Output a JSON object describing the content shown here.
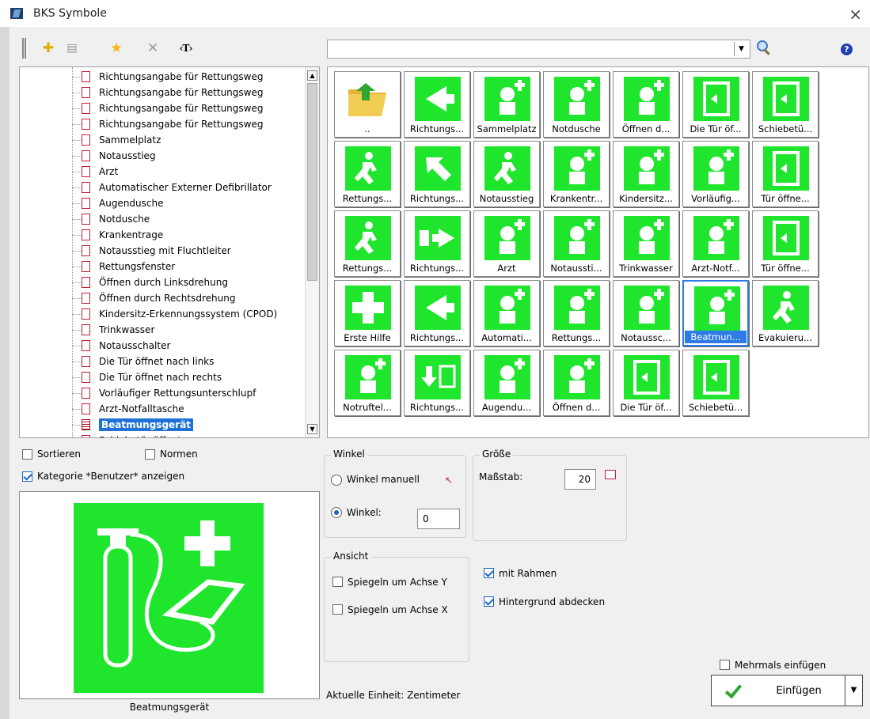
{
  "window": {
    "title": "BKS Symbole",
    "close_glyph": "×"
  },
  "toolbar": {
    "buttons": [
      {
        "name": "add-symbol-button",
        "icon": "plus-icon",
        "glyph": "✚"
      },
      {
        "name": "properties-button",
        "icon": "list-icon",
        "glyph": "▤"
      },
      {
        "name": "favorite-button",
        "icon": "star-icon",
        "glyph": "★"
      },
      {
        "name": "delete-button",
        "icon": "close-icon",
        "glyph": "✕"
      },
      {
        "name": "text-button",
        "icon": "text-icon",
        "glyph": "‹T›"
      }
    ]
  },
  "search": {
    "value": "",
    "placeholder": "",
    "dropdown_glyph": "▼"
  },
  "help_glyph": "?",
  "tree": {
    "items": [
      {
        "label": "Richtungsangabe für Rettungsweg"
      },
      {
        "label": "Richtungsangabe für Rettungsweg"
      },
      {
        "label": "Richtungsangabe für Rettungsweg"
      },
      {
        "label": "Richtungsangabe für Rettungsweg"
      },
      {
        "label": "Sammelplatz"
      },
      {
        "label": "Notausstieg"
      },
      {
        "label": "Arzt"
      },
      {
        "label": "Automatischer Externer Defibrillator"
      },
      {
        "label": "Augendusche"
      },
      {
        "label": "Notdusche"
      },
      {
        "label": "Krankentrage"
      },
      {
        "label": "Notausstieg mit Fluchtleiter"
      },
      {
        "label": "Rettungsfenster"
      },
      {
        "label": "Öffnen durch Linksdrehung"
      },
      {
        "label": "Öffnen durch Rechtsdrehung"
      },
      {
        "label": "Kindersitz-Erkennungssystem (CPOD)"
      },
      {
        "label": "Trinkwasser"
      },
      {
        "label": "Notausschalter"
      },
      {
        "label": "Die Tür öffnet nach links"
      },
      {
        "label": "Die Tür öffnet nach rechts"
      },
      {
        "label": "Vorläufiger Rettungsunterschlupf"
      },
      {
        "label": "Arzt-Notfalltasche"
      },
      {
        "label": "Beatmungsgerät",
        "selected": true
      },
      {
        "label": "Schiebetür öffnet"
      }
    ]
  },
  "symbols": [
    {
      "label": "..",
      "icon": "folder-up-icon"
    },
    {
      "label": "Richtungs...",
      "icon": "arrow-left-icon"
    },
    {
      "label": "Sammelplatz",
      "icon": "assembly-point-icon"
    },
    {
      "label": "Notdusche",
      "icon": "emergency-shower-icon"
    },
    {
      "label": "Öffnen d...",
      "icon": "rotate-open-icon"
    },
    {
      "label": "Die Tür öf...",
      "icon": "door-open-icon"
    },
    {
      "label": "Schiebetü...",
      "icon": "sliding-door-icon"
    },
    {
      "label": "Rettungs...",
      "icon": "running-man-icon"
    },
    {
      "label": "Richtungs...",
      "icon": "arrow-up-left-icon"
    },
    {
      "label": "Notausstieg",
      "icon": "emergency-exit-icon"
    },
    {
      "label": "Krankentr...",
      "icon": "stretcher-icon"
    },
    {
      "label": "Kindersitz...",
      "icon": "child-seat-icon"
    },
    {
      "label": "Vorläufig...",
      "icon": "refuge-icon"
    },
    {
      "label": "Tür öffne...",
      "icon": "door-icon"
    },
    {
      "label": "Rettungs...",
      "icon": "running-man-icon"
    },
    {
      "label": "Richtungs...",
      "icon": "arrow-right-icon"
    },
    {
      "label": "Arzt",
      "icon": "doctor-icon"
    },
    {
      "label": "Notaussti...",
      "icon": "escape-ladder-icon"
    },
    {
      "label": "Trinkwasser",
      "icon": "drinking-water-icon"
    },
    {
      "label": "Arzt-Notf...",
      "icon": "first-aid-bag-icon"
    },
    {
      "label": "Tür öffne...",
      "icon": "door-icon"
    },
    {
      "label": "Erste Hilfe",
      "icon": "first-aid-cross-icon"
    },
    {
      "label": "Richtungs...",
      "icon": "arrow-left-icon"
    },
    {
      "label": "Automati...",
      "icon": "defibrillator-icon"
    },
    {
      "label": "Rettungs...",
      "icon": "rescue-window-icon"
    },
    {
      "label": "Notaussc...",
      "icon": "emergency-stop-icon"
    },
    {
      "label": "Beatmun...",
      "icon": "ventilator-icon",
      "selected": true
    },
    {
      "label": "Evakuieru...",
      "icon": "evacuation-icon"
    },
    {
      "label": "Notruftel...",
      "icon": "emergency-phone-icon"
    },
    {
      "label": "Richtungs...",
      "icon": "arrow-down-icon"
    },
    {
      "label": "Augendu...",
      "icon": "eye-shower-icon"
    },
    {
      "label": "Öffnen d...",
      "icon": "rotate-open-icon"
    },
    {
      "label": "Die Tür öf...",
      "icon": "door-open-icon"
    },
    {
      "label": "Schiebetü...",
      "icon": "sliding-door-icon"
    }
  ],
  "options": {
    "sort_label": "Sortieren",
    "sort_checked": false,
    "norms_label": "Normen",
    "norms_checked": false,
    "category_label": "Kategorie *Benutzer* anzeigen",
    "category_checked": true
  },
  "preview": {
    "caption": "Beatmungsgerät"
  },
  "angle": {
    "title": "Winkel",
    "manual_label": "Winkel manuell",
    "angle_label": "Winkel:",
    "angle_value": "0",
    "selected": "angle"
  },
  "size": {
    "title": "Größe",
    "scale_label": "Maßstab:",
    "scale_value": "20"
  },
  "view": {
    "title": "Ansicht",
    "mirror_y_label": "Spiegeln um Achse Y",
    "mirror_y_checked": false,
    "mirror_x_label": "Spiegeln um Achse X",
    "mirror_x_checked": false
  },
  "frame": {
    "label": "mit Rahmen",
    "checked": true
  },
  "background": {
    "label": "Hintergrund abdecken",
    "checked": true
  },
  "unit_text": "Aktuelle Einheit: Zentimeter",
  "multi_insert": {
    "label": "Mehrmals einfügen",
    "checked": false
  },
  "insert_button": {
    "label": "Einfügen",
    "dropdown_glyph": "▼"
  },
  "colors": {
    "sign_green": "#1fe62c",
    "selection_blue": "#2e7be6"
  }
}
